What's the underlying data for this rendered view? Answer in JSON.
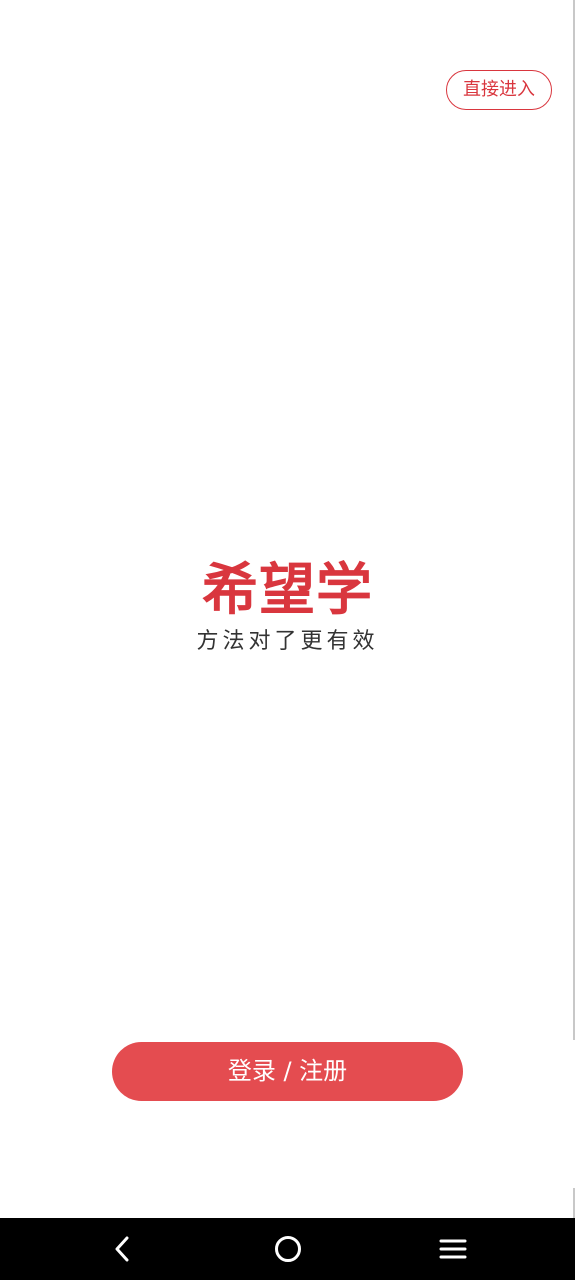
{
  "header": {
    "skip_label": "直接进入"
  },
  "logo": {
    "title": "希望学",
    "slogan": "方法对了更有效"
  },
  "actions": {
    "login_label": "登录 / 注册",
    "accent_color": "#e44c50"
  },
  "system_nav": {
    "icons": [
      "back-icon",
      "home-icon",
      "menu-icon"
    ]
  }
}
